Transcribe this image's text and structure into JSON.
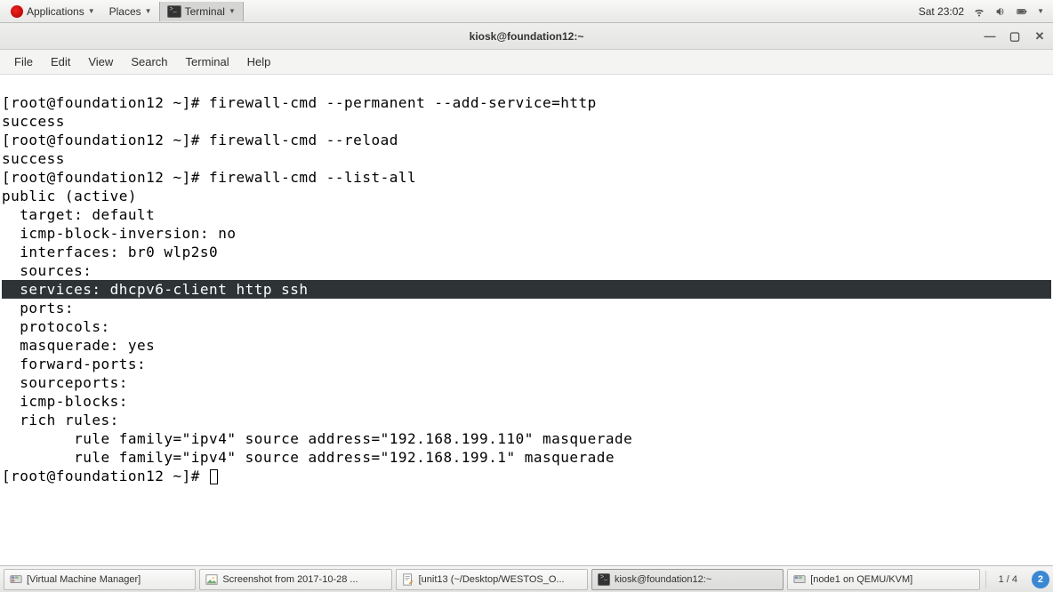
{
  "top_panel": {
    "applications": "Applications",
    "places": "Places",
    "terminal": "Terminal",
    "clock": "Sat 23:02"
  },
  "window": {
    "title": "kiosk@foundation12:~"
  },
  "menubar": {
    "file": "File",
    "edit": "Edit",
    "view": "View",
    "search": "Search",
    "terminal": "Terminal",
    "help": "Help"
  },
  "terminal": {
    "lines": [
      "",
      "[root@foundation12 ~]# firewall-cmd --permanent --add-service=http",
      "success",
      "[root@foundation12 ~]# firewall-cmd --reload",
      "success",
      "[root@foundation12 ~]# firewall-cmd --list-all",
      "public (active)",
      "  target: default",
      "  icmp-block-inversion: no",
      "  interfaces: br0 wlp2s0",
      "  sources: "
    ],
    "highlight": "  services: dhcpv6-client http ssh",
    "lines2": [
      "  ports: ",
      "  protocols: ",
      "  masquerade: yes",
      "  forward-ports: ",
      "  sourceports: ",
      "  icmp-blocks: ",
      "  rich rules: ",
      "\trule family=\"ipv4\" source address=\"192.168.199.110\" masquerade",
      "\trule family=\"ipv4\" source address=\"192.168.199.1\" masquerade"
    ],
    "prompt": "[root@foundation12 ~]# "
  },
  "taskbar": {
    "items": [
      "[Virtual Machine Manager]",
      "Screenshot from 2017-10-28 ...",
      "[unit13 (~/Desktop/WESTOS_O...",
      "kiosk@foundation12:~",
      "[node1 on QEMU/KVM]"
    ],
    "workspace": "1 / 4",
    "badge": "2"
  }
}
